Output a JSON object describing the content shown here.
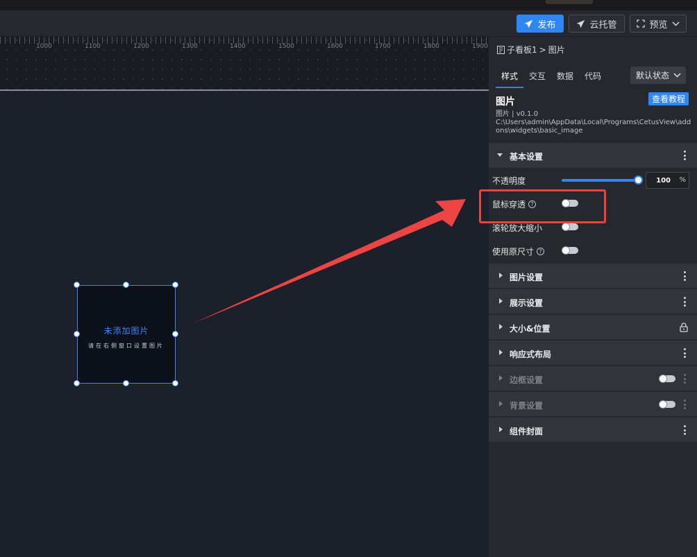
{
  "toolbar": {
    "publish_label": "发布",
    "cloud_label": "云托管",
    "preview_label": "预览"
  },
  "ruler": {
    "labels": [
      "1000",
      "1100",
      "1200",
      "1300",
      "1400",
      "1500",
      "1600",
      "1700",
      "1800",
      "1900"
    ]
  },
  "canvas": {
    "widget_title": "未添加图片",
    "widget_hint": "请在右侧窗口设置图片"
  },
  "panel": {
    "breadcrumb": {
      "parent": "子看板1",
      "separator": ">",
      "current": "图片"
    },
    "tabs": [
      "样式",
      "交互",
      "数据",
      "代码"
    ],
    "active_tab": "样式",
    "state_select": "默认状态",
    "component": {
      "name": "图片",
      "version": "图片 | v0.1.0",
      "path": "C:\\Users\\admin\\AppData\\Local\\Programs\\CetusView\\addons\\widgets\\basic_image",
      "tutorial_label": "查看教程"
    },
    "basic_settings": {
      "title": "基本设置",
      "opacity_label": "不透明度",
      "opacity_value": "100",
      "opacity_unit": "%",
      "mouse_passthrough_label": "鼠标穿透",
      "wheel_zoom_label": "滚轮放大缩小",
      "original_size_label": "使用原尺寸"
    },
    "sections": [
      {
        "title": "图片设置"
      },
      {
        "title": "展示设置"
      },
      {
        "title": "大小&位置"
      },
      {
        "title": "响应式布局"
      },
      {
        "title": "边框设置"
      },
      {
        "title": "背景设置"
      },
      {
        "title": "组件封面"
      }
    ]
  },
  "colors": {
    "accent": "#2f86f6",
    "annotation_red": "#f04040",
    "canvas_bg": "#1b202a",
    "panel_bg": "#26282d"
  }
}
